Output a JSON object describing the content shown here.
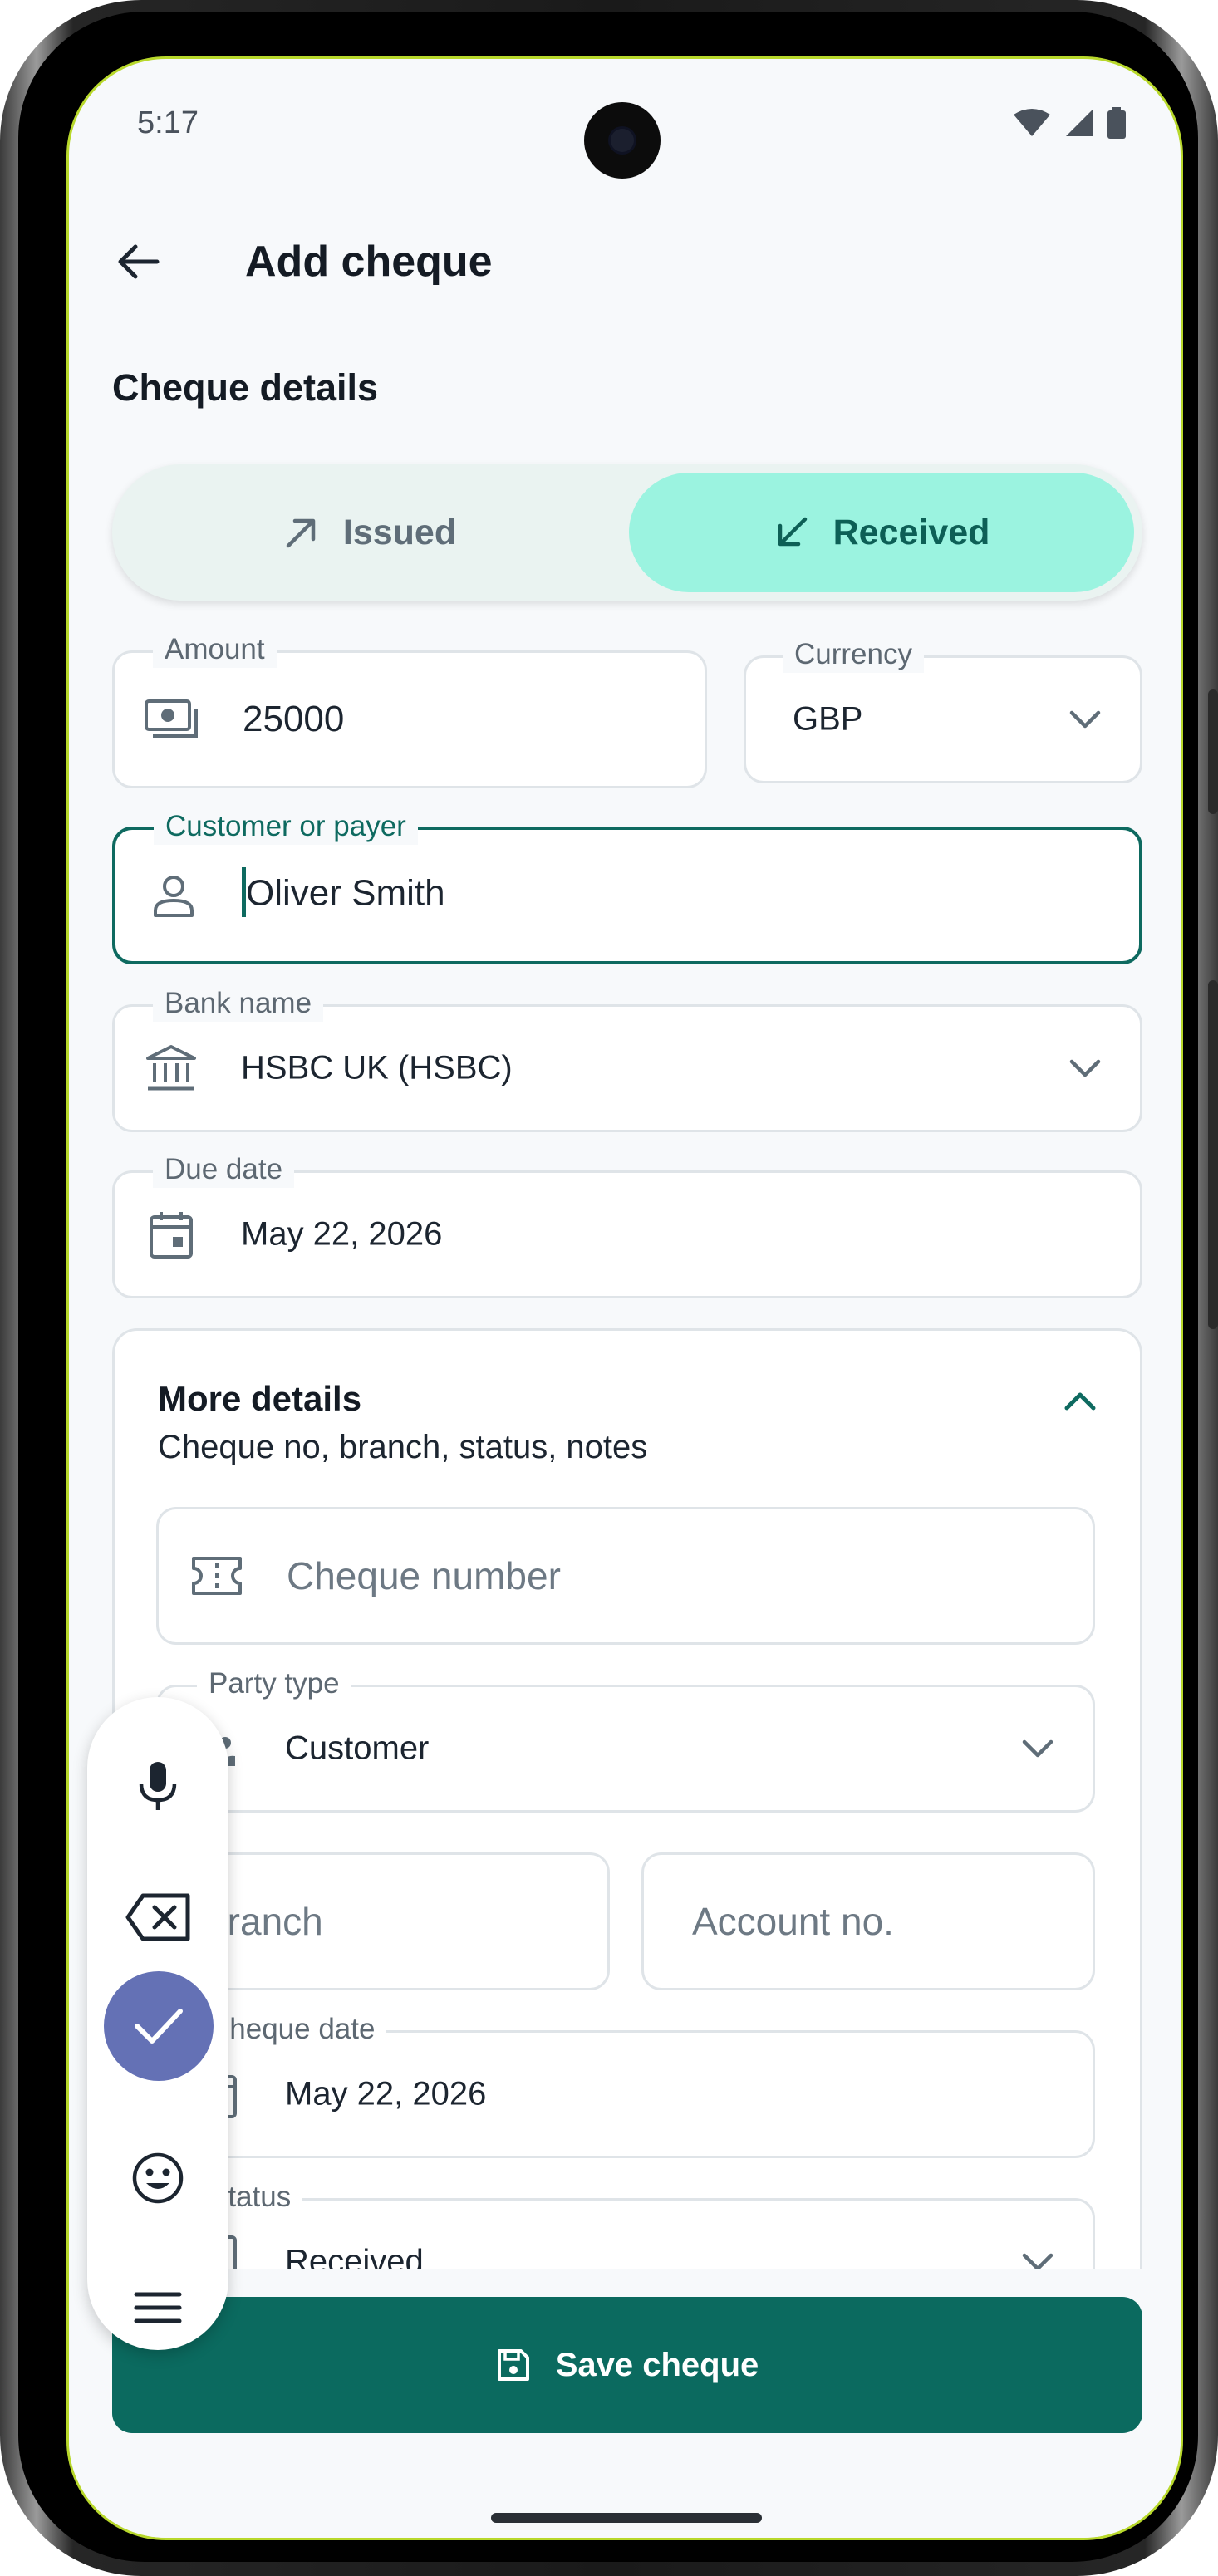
{
  "status_bar": {
    "time": "5:17"
  },
  "app_bar": {
    "title": "Add cheque"
  },
  "section_title": "Cheque details",
  "direction_toggle": {
    "issued_label": "Issued",
    "received_label": "Received",
    "selected": "Received"
  },
  "amount": {
    "label": "Amount",
    "value": "25000"
  },
  "currency": {
    "label": "Currency",
    "value": "GBP"
  },
  "customer": {
    "label": "Customer or payer",
    "value": "Oliver Smith"
  },
  "bank": {
    "label": "Bank name",
    "value": "HSBC UK (HSBC)"
  },
  "due_date": {
    "label": "Due date",
    "value": "May 22, 2026"
  },
  "more_details": {
    "title": "More details",
    "subtitle": "Cheque no, branch, status, notes",
    "cheque_number": {
      "placeholder": "Cheque number"
    },
    "party_type": {
      "label": "Party type",
      "value": "Customer"
    },
    "branch": {
      "placeholder": "Branch"
    },
    "account_no": {
      "placeholder": "Account no."
    },
    "cheque_date": {
      "label": "Cheque date",
      "value": "May 22, 2026"
    },
    "status": {
      "label": "Status",
      "value": "Received"
    }
  },
  "save_button": {
    "label": "Save cheque"
  },
  "keyboard_toolbar": {
    "items": [
      "mic-icon",
      "backspace-icon",
      "check-icon",
      "emoji-icon",
      "menu-icon"
    ]
  },
  "colors": {
    "primary": "#0b6a5f",
    "selected_segment": "#9bf3e0",
    "focus_border": "#0e6a60",
    "toolbar_accent": "#6471b5"
  }
}
